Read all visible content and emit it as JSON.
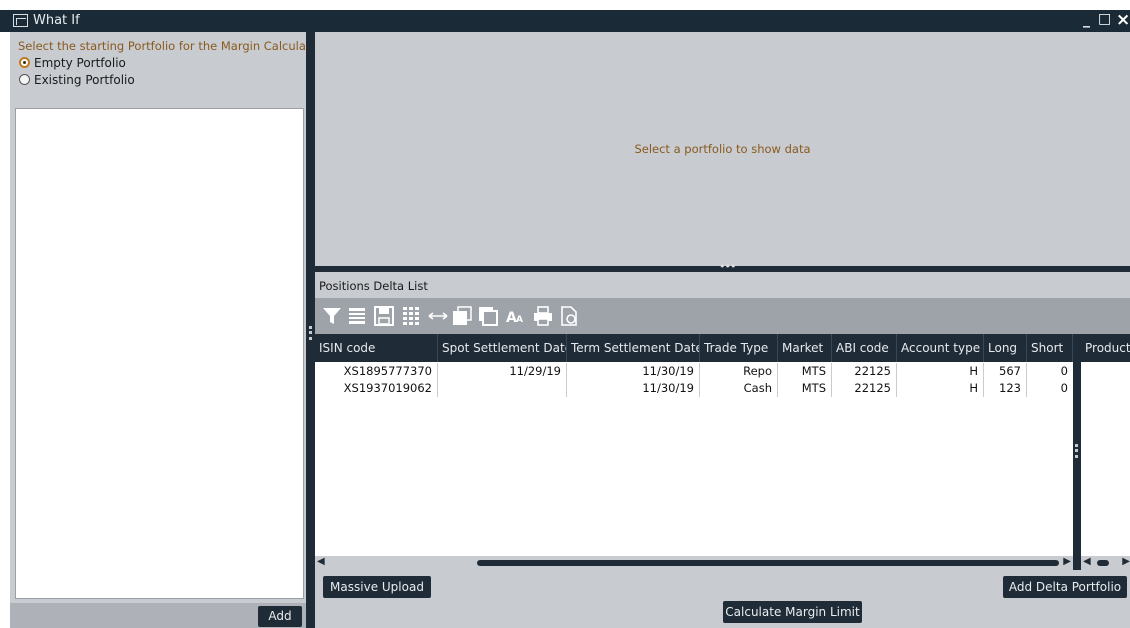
{
  "window": {
    "title": "What If",
    "minimize_glyph": "_",
    "maximize_glyph": "□",
    "close_glyph": "×"
  },
  "left_panel": {
    "prompt": "Select the starting Portfolio for the Margin Calculation",
    "options": [
      {
        "label": "Empty Portfolio",
        "selected": true
      },
      {
        "label": "Existing Portfolio",
        "selected": false
      }
    ],
    "add_label": "Add"
  },
  "top_panel": {
    "empty_message": "Select a portfolio to show data"
  },
  "positions": {
    "title": "Positions Delta List",
    "toolbar_icons": [
      "filter-icon",
      "list-icon",
      "save-icon",
      "columns-icon",
      "arrow-range-icon",
      "window-icon",
      "copy-icon",
      "font-size-icon",
      "print-icon",
      "export-icon"
    ],
    "columns": [
      "ISIN code",
      "Spot Settlement Date",
      "Term Settlement Date",
      "Trade Type",
      "Market",
      "ABI code",
      "Account type",
      "Long",
      "Short",
      "Product"
    ],
    "rows": [
      [
        "XS1895777370",
        "11/29/19",
        "11/30/19",
        "Repo",
        "MTS",
        "22125",
        "H",
        "567",
        "0"
      ],
      [
        "XS1937019062",
        "",
        "11/30/19",
        "Cash",
        "MTS",
        "22125",
        "H",
        "123",
        "0"
      ]
    ],
    "massive_upload_label": "Massive Upload",
    "add_delta_label": "Add Delta Portfolio",
    "calculate_label": "Calculate Margin Limit"
  },
  "colors": {
    "dark": "#1f2b36",
    "panel": "#c8cbd0",
    "accent_text": "#8a5a1e",
    "radio_selected": "#c07b1f"
  }
}
